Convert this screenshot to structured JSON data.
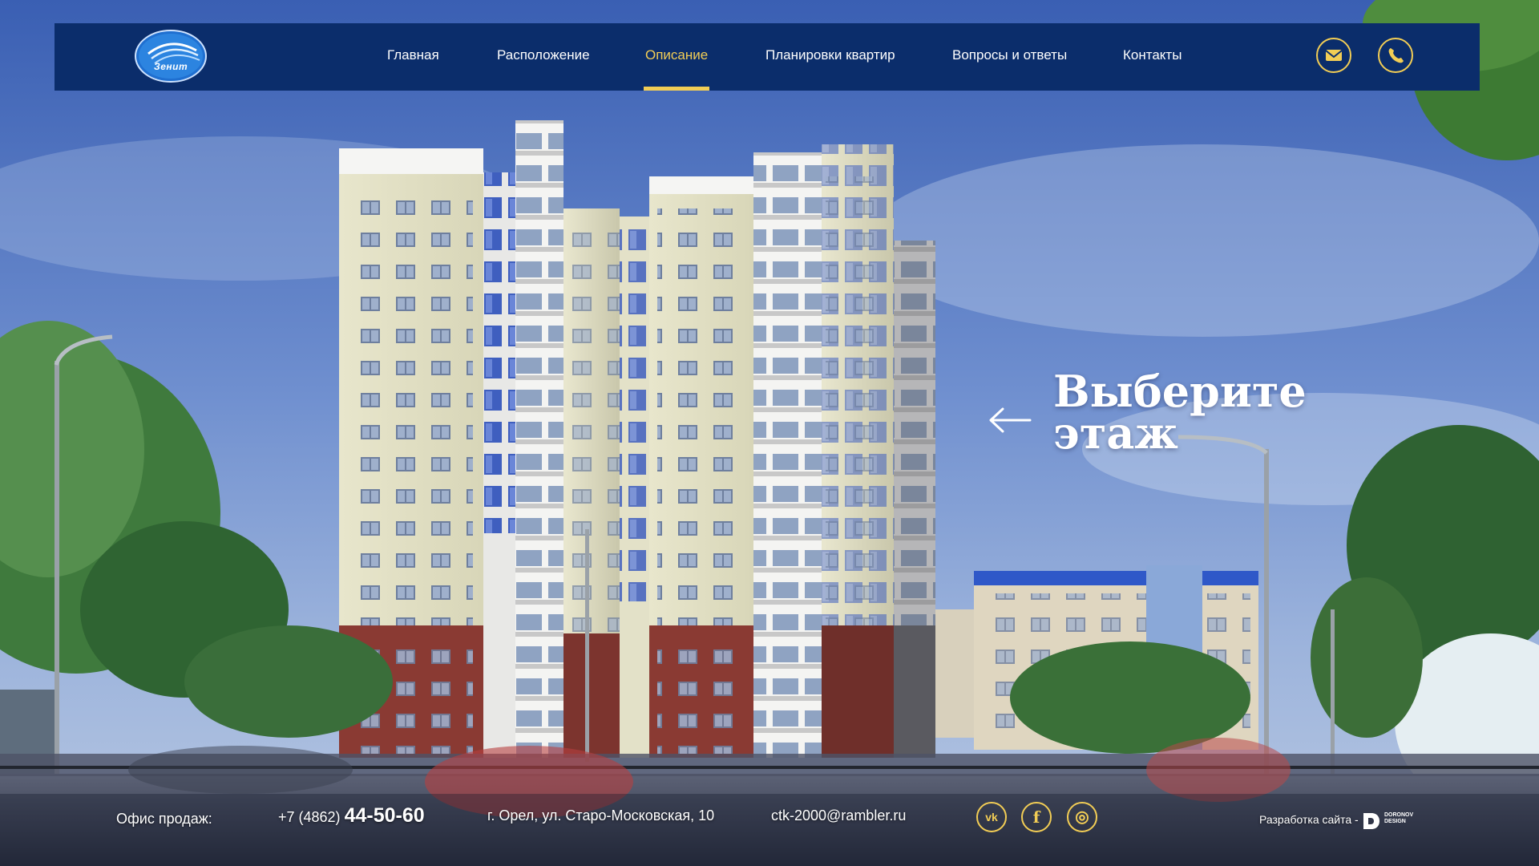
{
  "brand": {
    "logo_text": "Зенит"
  },
  "nav": {
    "items": [
      {
        "label": "Главная"
      },
      {
        "label": "Расположение"
      },
      {
        "label": "Описание",
        "active": true
      },
      {
        "label": "Планировки квартир"
      },
      {
        "label": "Вопросы и ответы"
      },
      {
        "label": "Контакты"
      }
    ]
  },
  "header_icons": {
    "mail": "mail-icon",
    "phone": "phone-icon"
  },
  "hero": {
    "title_line1": "Выберите",
    "title_line2": "этаж",
    "arrow_icon": "arrow-left-icon"
  },
  "footer": {
    "office_label": "Офис продаж:",
    "phone_prefix": "+7 (4862)",
    "phone_number": "44-50-60",
    "address": "г. Орел, ул. Старо-Московская, 10",
    "email": "ctk-2000@rambler.ru",
    "social": [
      {
        "name": "vk-icon",
        "glyph": "vk"
      },
      {
        "name": "facebook-icon",
        "glyph": "f"
      },
      {
        "name": "instagram-icon",
        "glyph": "◎"
      }
    ],
    "dev_label": "Разработка сайта -",
    "dev_logo_line1": "DORONOV",
    "dev_logo_line2": "DESIGN"
  },
  "colors": {
    "header_bg": "#0b2d6b",
    "accent": "#f2cd55",
    "text": "#ffffff"
  }
}
